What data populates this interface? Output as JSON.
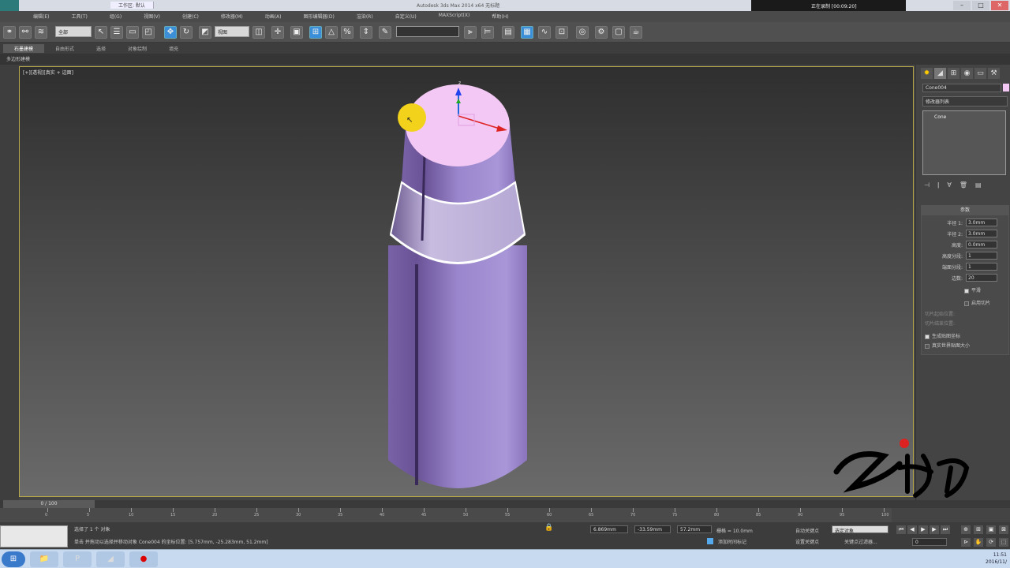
{
  "titlebar": {
    "menu": [
      "工作区: 默认"
    ],
    "title": "Autodesk 3ds Max 2014 x64    无标题",
    "recorder": "正在录制 [00:09:20]"
  },
  "menubar": {
    "items": [
      "编辑(E)",
      "工具(T)",
      "组(G)",
      "视图(V)",
      "创建(C)",
      "修改器(M)",
      "动画(A)",
      "图形编辑器(D)",
      "渲染(R)",
      "自定义(U)",
      "MAXScript(X)",
      "帮助(H)"
    ]
  },
  "toolbar": {
    "select_filter": "全部",
    "ref_coord": "视图",
    "named_set": ""
  },
  "ribbon": {
    "tabs": [
      "石墨建模",
      "自由形式",
      "选择",
      "对象绘制",
      "填充"
    ],
    "sub": "多边形建模"
  },
  "viewport": {
    "label": "[+][透视][真实 + 边面]"
  },
  "cmdpanel": {
    "object_name": "Cone004",
    "modifier_list": "修改器列表",
    "stack_item": "Cone",
    "rollout_title": "参数",
    "params": [
      {
        "label": "半径 1:",
        "value": "3.0mm"
      },
      {
        "label": "半径 2:",
        "value": "3.0mm"
      },
      {
        "label": "高度:",
        "value": "0.0mm"
      },
      {
        "label": "高度分段:",
        "value": "1"
      },
      {
        "label": "端面分段:",
        "value": "1"
      },
      {
        "label": "边数:",
        "value": "20"
      }
    ],
    "smooth": "平滑",
    "slice_on": "启用切片",
    "slice_from": "切片起始位置:",
    "slice_to": "切片结束位置:",
    "gen_map": "生成贴图坐标",
    "real_world": "真实世界贴图大小"
  },
  "timeline": {
    "slider": "0 / 100",
    "ticks": [
      "0",
      "5",
      "10",
      "15",
      "20",
      "25",
      "30",
      "35",
      "40",
      "45",
      "50",
      "55",
      "60",
      "65",
      "70",
      "75",
      "80",
      "85",
      "90",
      "95",
      "100"
    ]
  },
  "status": {
    "selected": "选择了 1 个 对象",
    "prompt": "单击 并拖动以选择并移动对象",
    "coords": "Cone004 的坐标位置: [5.757mm, -25.283mm, 51.2mm]",
    "x": "6.869mm",
    "y": "-33.59mm",
    "z": "57.2mm",
    "grid": "栅格 = 10.0mm",
    "autokey": "自动关键点",
    "selected_set": "选定对象",
    "setkey": "设置关键点",
    "keyfilter": "关键点过滤器...",
    "add_time_tag": "添加时间标记",
    "frame": "0"
  },
  "taskbar": {
    "time": "11:51",
    "date": "2016/11/"
  }
}
